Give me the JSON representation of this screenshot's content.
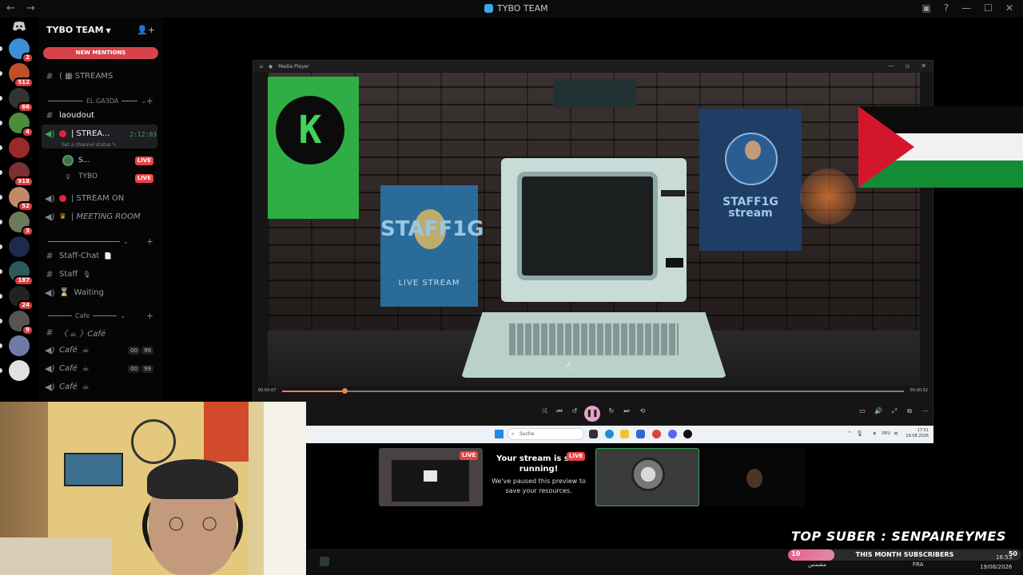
{
  "titlebar": {
    "title": "TYBO TEAM",
    "back": "←",
    "forward": "→",
    "minimize": "—",
    "maximize": "☐",
    "close": "✕",
    "inbox": "▣",
    "help": "?"
  },
  "rail": {
    "home_icon": "discord-icon",
    "servers": [
      {
        "badge": "2",
        "color": "#3b8fd4"
      },
      {
        "badge": "512",
        "color": "#c0502a"
      },
      {
        "badge": "66",
        "color": "#333333"
      },
      {
        "badge": "4",
        "color": "#4c8c3a"
      },
      {
        "badge": "",
        "color": "#9a2a2a"
      },
      {
        "badge": "918",
        "color": "#7a3030"
      },
      {
        "badge": "52",
        "color": "#c08a66"
      },
      {
        "badge": "3",
        "color": "#6a7a5a"
      },
      {
        "badge": "",
        "color": "#1d2a4a"
      },
      {
        "badge": "187",
        "color": "#2b5a5a"
      },
      {
        "badge": "24",
        "color": "#222222"
      },
      {
        "badge": "9",
        "color": "#555555"
      },
      {
        "badge": "",
        "color": "#6e7aa8"
      },
      {
        "badge": "",
        "color": "#e0e0e0"
      }
    ]
  },
  "sidebar": {
    "server_name": "TYBO TEAM",
    "new_mentions": "NEW MENTIONS",
    "streams": "STREAMS",
    "cat_elgada": "EL GA3DA",
    "laoudout": "laoudout",
    "stream_channel": "| STREA...",
    "stream_time": "2:12:03",
    "set_status": "Set a channel status",
    "user1": "S...",
    "user2": "TYBO",
    "live": "LIVE",
    "stream_on": "| STREAM ON",
    "meeting_room": "| MEETING ROOM",
    "staff_chat": "Staff-Chat",
    "staff": "Staff",
    "waiting": "Waiting",
    "cat_cafe": "Cafe",
    "cafe_text": "〈 ☕ 〉Café",
    "cafe_voice": "Café",
    "count_a": "00",
    "count_b": "99"
  },
  "player": {
    "app_title": "Media Player",
    "time_current": "00:00:07",
    "time_total": "00:00:52",
    "progress": 0.1,
    "poster_k_letter": "K",
    "poster_s1_title": "STAFF1G",
    "poster_s1_sub": "LIVE STREAM",
    "poster_s2_title": "STAFF1G",
    "poster_s2_sub": "stream"
  },
  "inner_taskbar": {
    "search_placeholder": "Suche",
    "lang": "DEU",
    "time": "17:51",
    "date": "19.08.2026"
  },
  "streams": {
    "paused_title": "Your stream is still running!",
    "paused_body": "We've paused this preview to save your resources.",
    "live": "LIVE"
  },
  "overlay": {
    "top_suber": "TOP SUBER : SENPAIREYMES",
    "subs_current": "10",
    "subs_label": "THIS MONTH SUBSCRIBERS",
    "subs_goal": "50",
    "subs_fraction": 0.2,
    "weather": "مشمس",
    "lang": "FRA",
    "time": "16:53",
    "date": "19/08/2026"
  },
  "colors": {
    "accent_live": "#ed4245",
    "flag_red": "#d4162d",
    "flag_green": "#138d35",
    "progress": "#e9874e"
  }
}
